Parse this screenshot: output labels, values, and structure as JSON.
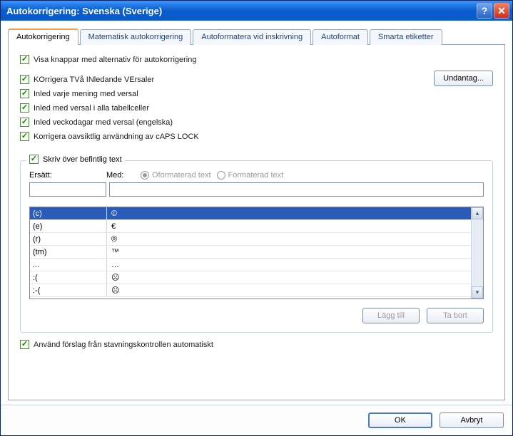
{
  "title": "Autokorrigering: Svenska (Sverige)",
  "tabs": [
    {
      "label": "Autokorrigering",
      "active": true
    },
    {
      "label": "Matematisk autokorrigering",
      "active": false
    },
    {
      "label": "Autoformatera vid inskrivning",
      "active": false
    },
    {
      "label": "Autoformat",
      "active": false
    },
    {
      "label": "Smarta etiketter",
      "active": false
    }
  ],
  "checks": {
    "show_buttons": "Visa knappar med alternativ för autokorrigering",
    "two_initial": "KOrrigera TVå INledande VErsaler",
    "cap_sentence": "Inled varje mening med versal",
    "cap_cells": "Inled med versal i alla tabellceller",
    "cap_days": "Inled veckodagar med versal (engelska)",
    "caps_lock": "Korrigera oavsiktlig användning av cAPS LOCK"
  },
  "exceptions_btn": "Undantag...",
  "group": {
    "legend": "Skriv över befintlig text",
    "replace_label": "Ersätt:",
    "with_label": "Med:",
    "radio_plain": "Oformaterad text",
    "radio_formatted": "Formaterad text",
    "add_btn": "Lägg till",
    "del_btn": "Ta bort"
  },
  "list": [
    {
      "from": "(c)",
      "to": "©"
    },
    {
      "from": "(e)",
      "to": "€"
    },
    {
      "from": "(r)",
      "to": "®"
    },
    {
      "from": "(tm)",
      "to": "™"
    },
    {
      "from": "...",
      "to": "…"
    },
    {
      "from": ":(",
      "to": "☹"
    },
    {
      "from": ":-(",
      "to": "☹"
    }
  ],
  "spell_check": "Använd förslag från stavningskontrollen automatiskt",
  "ok_btn": "OK",
  "cancel_btn": "Avbryt"
}
